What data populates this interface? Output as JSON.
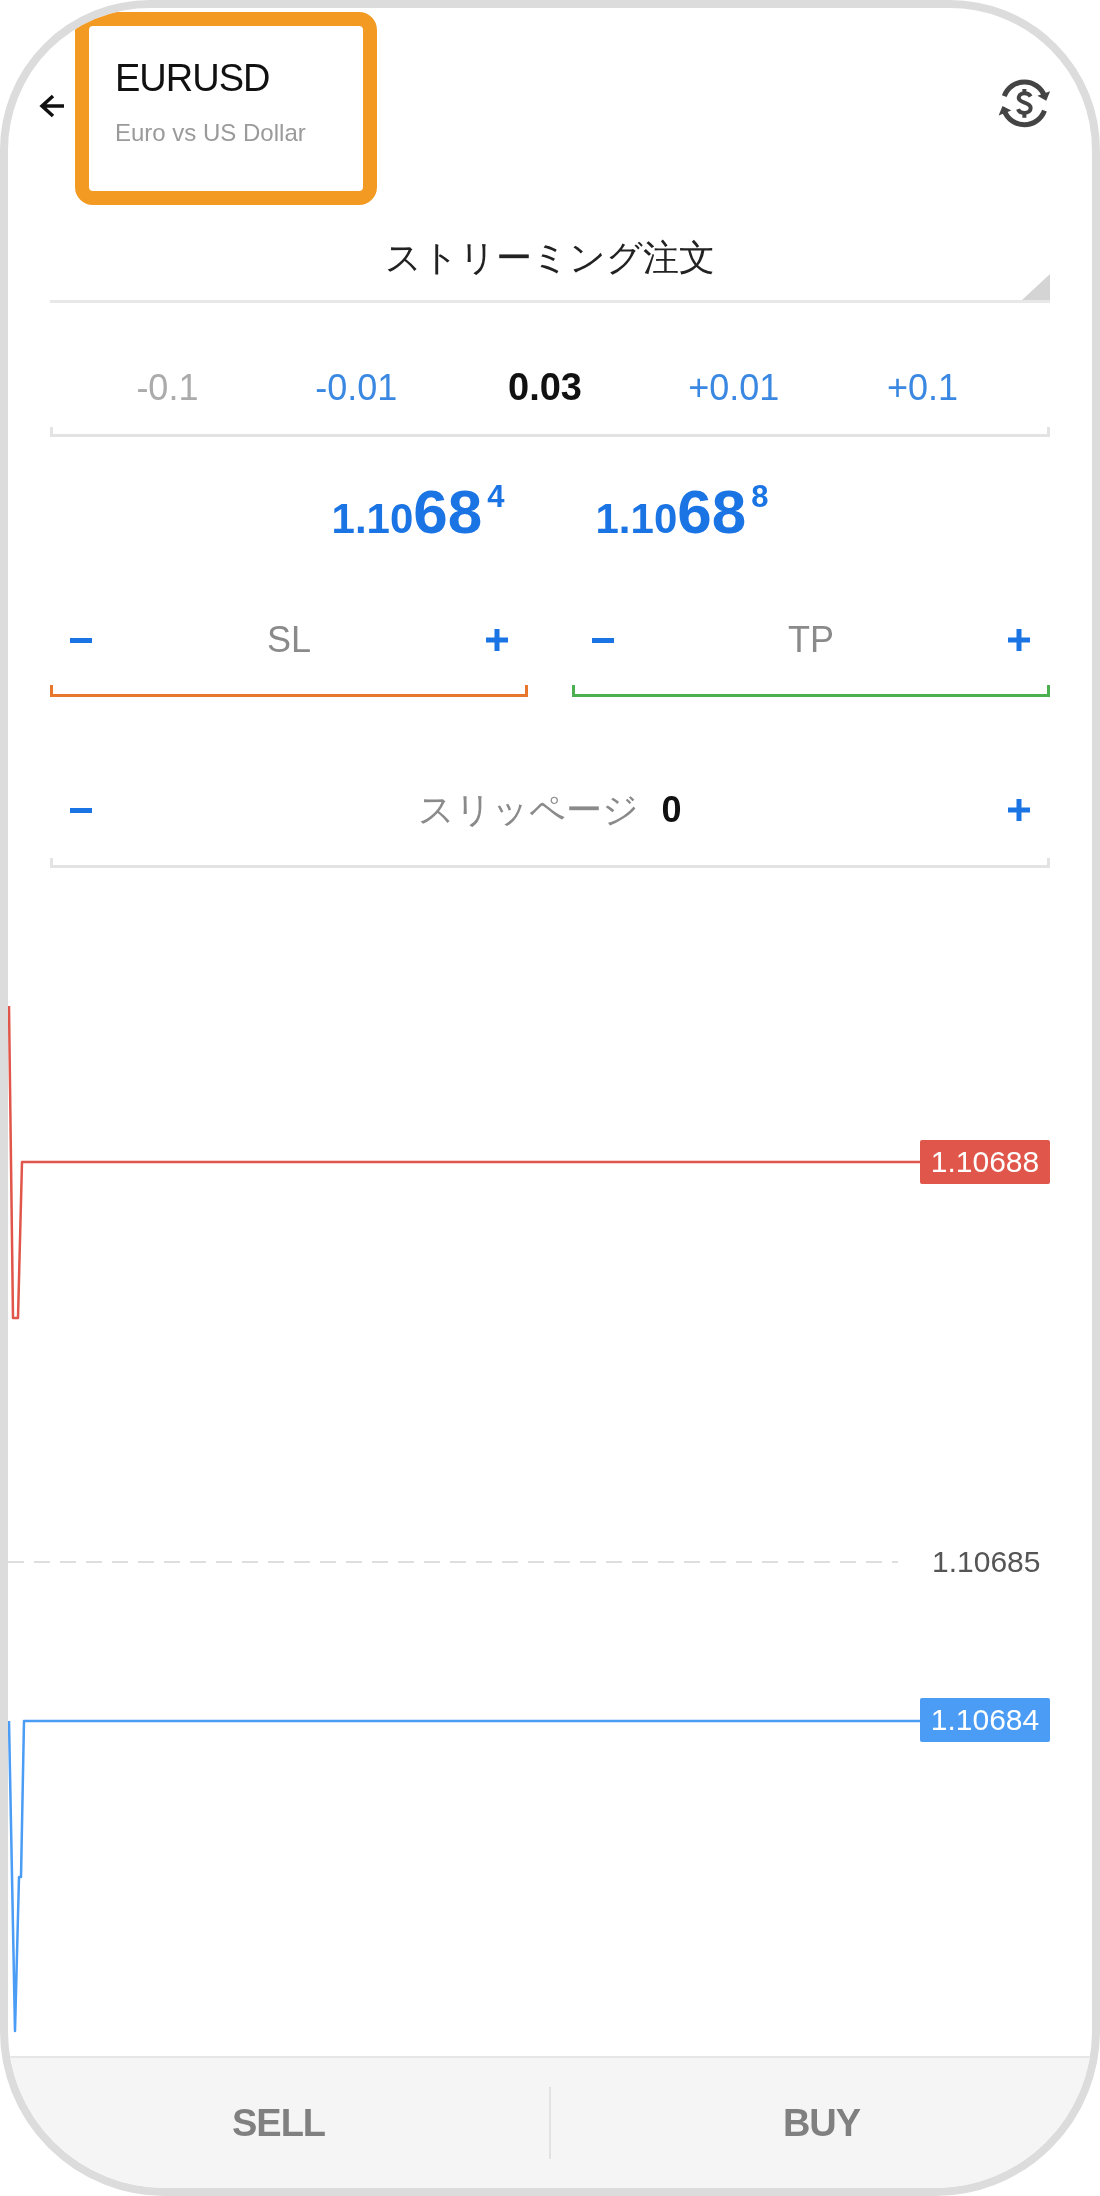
{
  "header": {
    "symbol": "EURUSD",
    "description": "Euro vs US Dollar",
    "highlighted": true
  },
  "order_type": {
    "value": "ストリーミング注文"
  },
  "volume": {
    "steps_down": [
      {
        "label": "-0.1",
        "disabled": true
      },
      {
        "label": "-0.01",
        "disabled": false
      }
    ],
    "value": "0.03",
    "steps_up": [
      {
        "label": "+0.01",
        "disabled": false
      },
      {
        "label": "+0.1",
        "disabled": false
      }
    ]
  },
  "quotes": [
    {
      "lead": "1.10",
      "pips": "68",
      "fraction": "4"
    },
    {
      "lead": "1.10",
      "pips": "68",
      "fraction": "8"
    }
  ],
  "stops": [
    {
      "placeholder": "SL",
      "color": "#e8772e"
    },
    {
      "placeholder": "TP",
      "color": "#4caf50"
    }
  ],
  "slippage": {
    "label": "スリッページ",
    "value": "0"
  },
  "chart": {
    "grid_label": "1.10685",
    "price_lines": [
      {
        "kind": "ask",
        "label": "1.10688",
        "color": "#e0564a"
      },
      {
        "kind": "bid",
        "label": "1.10684",
        "color": "#4a9cf5"
      }
    ]
  },
  "actions": [
    "SELL",
    "BUY"
  ]
}
